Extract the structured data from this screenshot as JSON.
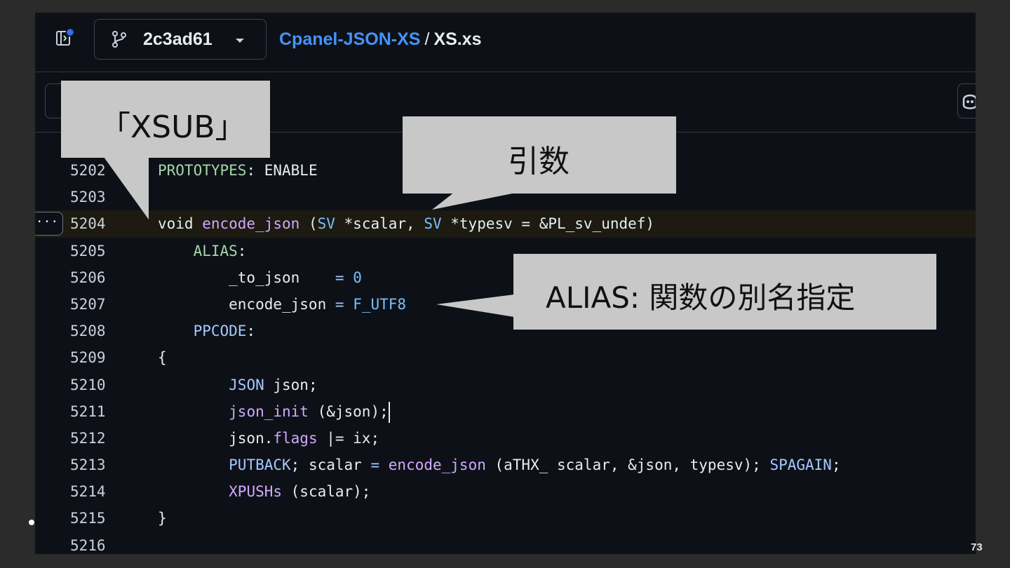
{
  "header": {
    "branch_name": "2c3ad61",
    "repo_name": "Cpanel-JSON-XS",
    "separator": "/",
    "file_name": "XS.xs"
  },
  "code_lines": [
    {
      "num": "5202",
      "text": "PROTOTYPES: ENABLE"
    },
    {
      "num": "5203",
      "text": ""
    },
    {
      "num": "5204",
      "text": "void encode_json (SV *scalar, SV *typesv = &PL_sv_undef)"
    },
    {
      "num": "5205",
      "text": "    ALIAS:"
    },
    {
      "num": "5206",
      "text": "        _to_json    = 0"
    },
    {
      "num": "5207",
      "text": "        encode_json = F_UTF8"
    },
    {
      "num": "5208",
      "text": "    PPCODE:"
    },
    {
      "num": "5209",
      "text": "{"
    },
    {
      "num": "5210",
      "text": "        JSON json;"
    },
    {
      "num": "5211",
      "text": "        json_init (&json);"
    },
    {
      "num": "5212",
      "text": "        json.flags |= ix;"
    },
    {
      "num": "5213",
      "text": "        PUTBACK; scalar = encode_json (aTHX_ scalar, &json, typesv); SPAGAIN;"
    },
    {
      "num": "5214",
      "text": "        XPUSHs (scalar);"
    },
    {
      "num": "5215",
      "text": "}"
    },
    {
      "num": "5216",
      "text": ""
    }
  ],
  "more_button_label": "···",
  "callouts": {
    "xsub": "「XSUB」",
    "args": "引数",
    "alias": "ALIAS: 関数の別名指定"
  },
  "slide_number": "73",
  "colors": {
    "background": "#2b2b2b",
    "panel": "#0d1117",
    "link": "#4493f8",
    "callout": "#c8c8c8",
    "highlight_row": "#1c1a11"
  }
}
